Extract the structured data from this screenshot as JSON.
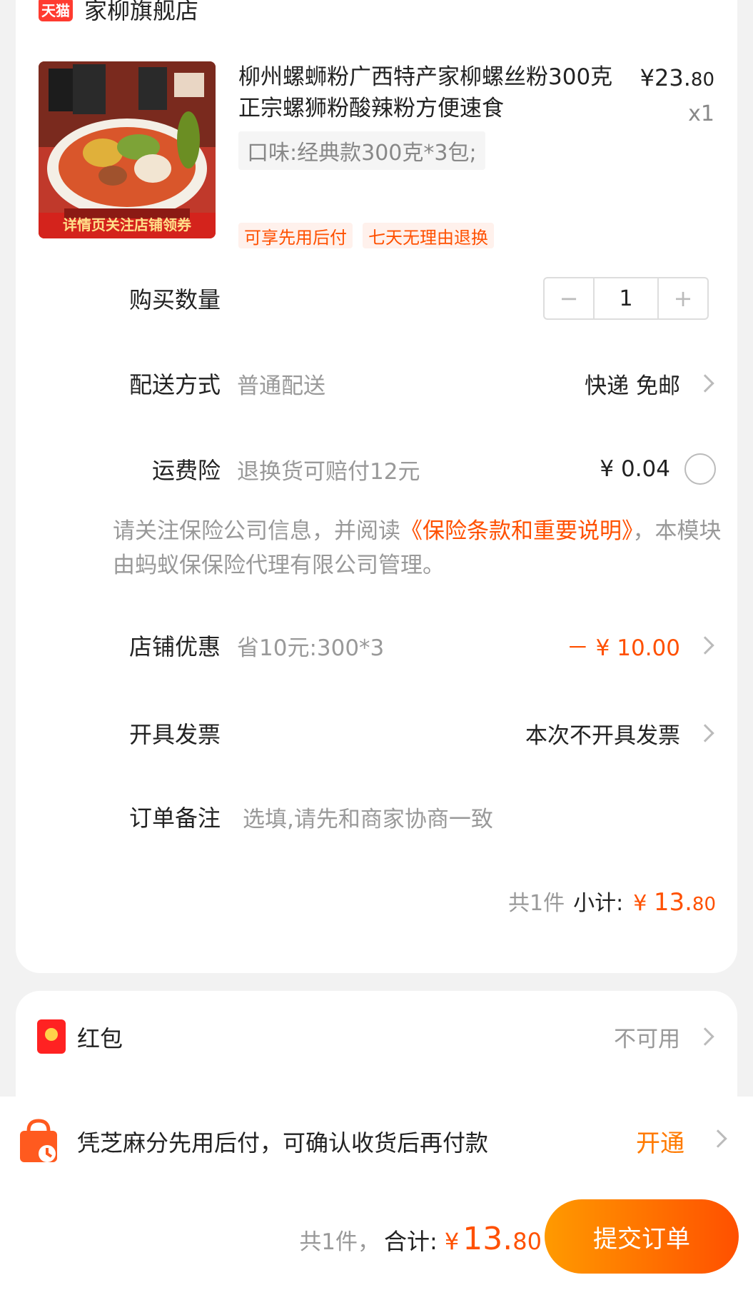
{
  "store": {
    "badge": "天猫",
    "name": "家柳旗舰店"
  },
  "product": {
    "title": "柳州螺蛳粉广西特产家柳螺丝粉300克正宗螺狮粉酸辣粉方便速食",
    "price_main": "¥23.",
    "price_cents": "80",
    "quantity": "x1",
    "flavor": "口味:经典款300克*3包;",
    "image_caption": "详情页关注店铺领券",
    "tags": [
      "可享先用后付",
      "七天无理由退换"
    ]
  },
  "rows": {
    "quantity": {
      "label": "购买数量",
      "minus": "−",
      "value": "1",
      "plus": "+"
    },
    "shipping": {
      "label": "配送方式",
      "desc": "普通配送",
      "value": "快递 免邮"
    },
    "insurance": {
      "label": "运费险",
      "desc": "退换货可赔付12元",
      "value": "¥ 0.04"
    },
    "store_discount": {
      "label": "店铺优惠",
      "desc": "省10元:300*3",
      "value": "－ ¥ 10.00"
    },
    "invoice": {
      "label": "开具发票",
      "value": "本次不开具发票"
    },
    "remark": {
      "label": "订单备注",
      "placeholder": "选填,请先和商家协商一致"
    }
  },
  "notice": {
    "prefix": "请关注保险公司信息，并阅读",
    "link": "《保险条款和重要说明》",
    "suffix": "，本模块由蚂蚁保保险代理有限公司管理。"
  },
  "subtotal": {
    "count": "共1件",
    "label": "小计:",
    "currency": "¥",
    "main": "13.",
    "cents": "80"
  },
  "red_packet": {
    "label": "红包",
    "status": "不可用"
  },
  "pay_later": {
    "text": "凭芝麻分先用后付，可确认收货后再付款",
    "action": "开通"
  },
  "footer": {
    "count": "共1件，",
    "label": "合计:",
    "currency": "¥",
    "main": "13.",
    "cents": "80",
    "submit": "提交订单"
  },
  "colors": {
    "accent": "#ff5000",
    "tmall_red": "#ff3b30"
  }
}
